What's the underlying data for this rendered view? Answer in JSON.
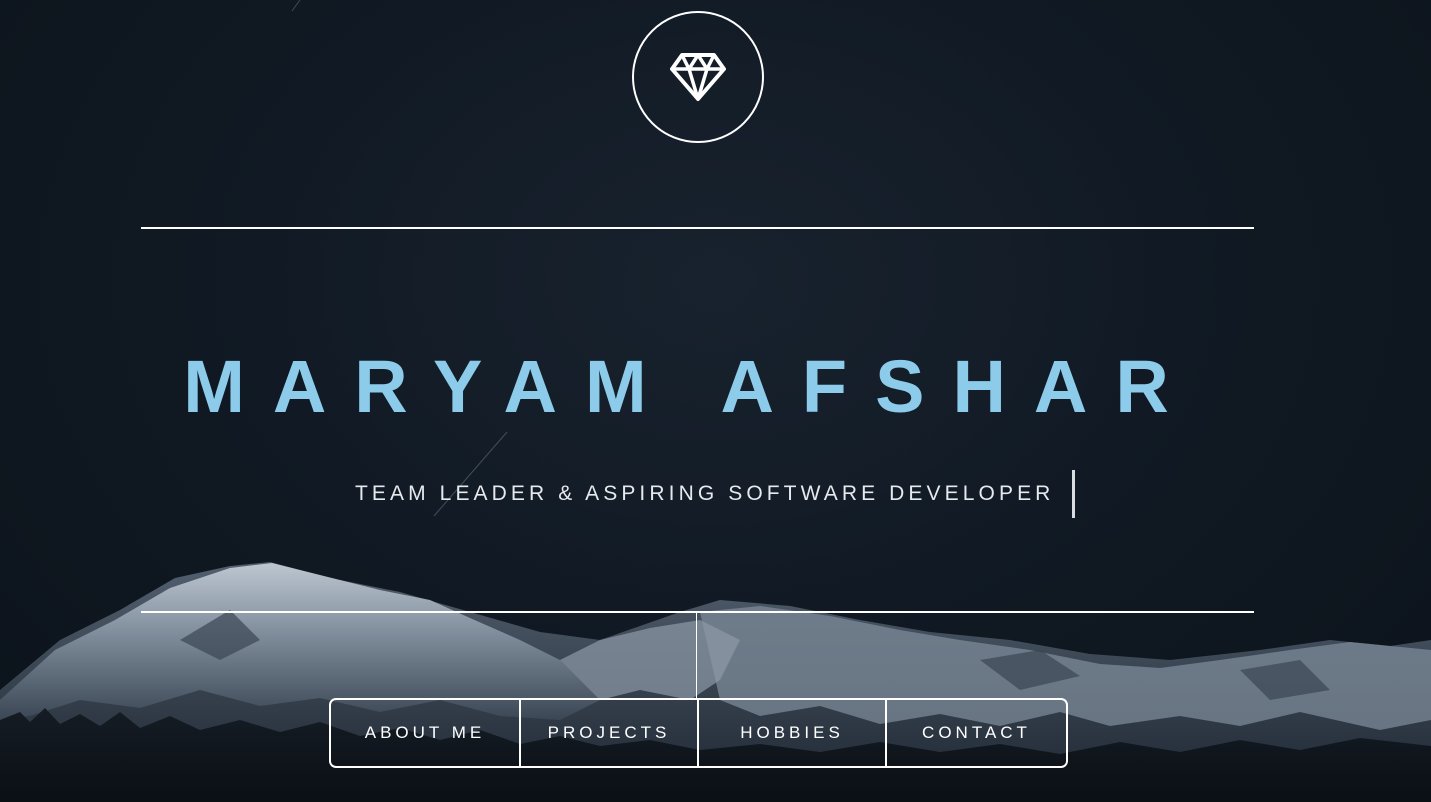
{
  "header": {
    "logo_icon": "diamond-icon"
  },
  "hero": {
    "name": "MARYAM AFSHAR",
    "tagline": "TEAM LEADER & ASPIRING SOFTWARE DEVELOPER"
  },
  "nav": {
    "items": [
      {
        "label": "ABOUT ME"
      },
      {
        "label": "PROJECTS"
      },
      {
        "label": "HOBBIES"
      },
      {
        "label": "CONTACT"
      }
    ]
  },
  "colors": {
    "background": "#0f1720",
    "accent_name": "#8ccbea",
    "text": "#ffffff"
  }
}
